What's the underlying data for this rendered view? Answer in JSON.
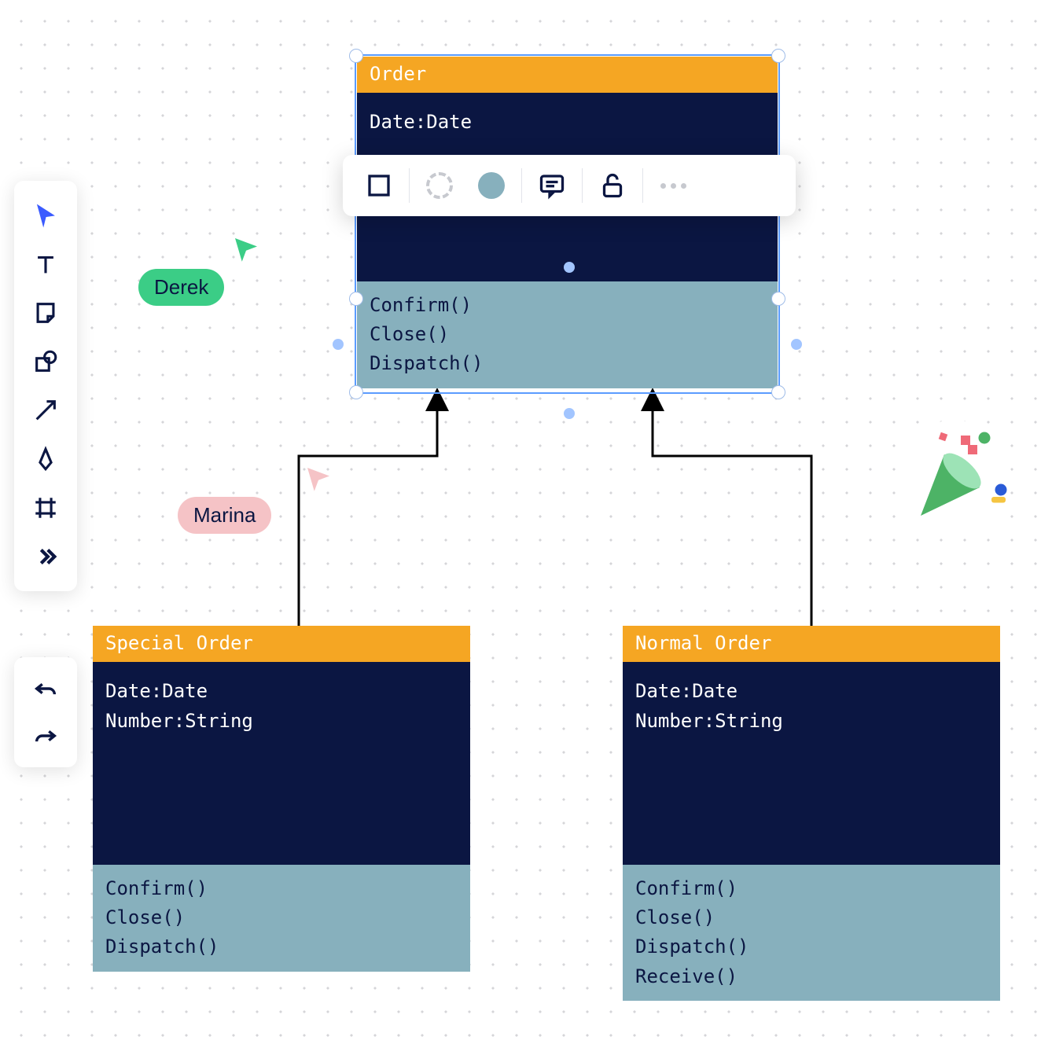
{
  "presence": {
    "derek": "Derek",
    "marina": "Marina"
  },
  "toolbox": {
    "select": "select",
    "text": "text",
    "sticky": "sticky-note",
    "shape": "shape",
    "arrow": "arrow",
    "pen": "pen",
    "frame": "frame",
    "more": "more",
    "undo": "undo",
    "redo": "redo"
  },
  "context_toolbar": {
    "shape_style": "square-outline",
    "border_style": "dashed",
    "fill_color": "#87b0bd",
    "comment": "comment",
    "lock": "unlock",
    "more": "more"
  },
  "diagram": {
    "order": {
      "title": "Order",
      "attrs": [
        "Date:Date"
      ],
      "methods": [
        "Confirm()",
        "Close()",
        "Dispatch()"
      ]
    },
    "special": {
      "title": "Special Order",
      "attrs": [
        "Date:Date",
        "Number:String"
      ],
      "methods": [
        "Confirm()",
        "Close()",
        "Dispatch()"
      ]
    },
    "normal": {
      "title": "Normal Order",
      "attrs": [
        "Date:Date",
        "Number:String"
      ],
      "methods": [
        "Confirm()",
        "Close()",
        "Dispatch()",
        "Receive()"
      ]
    }
  },
  "colors": {
    "header": "#f5a623",
    "body": "#0b1642",
    "footer": "#87b0bd",
    "selection": "#5b9cff",
    "derek": "#3bcd86",
    "marina": "#f5c3c6"
  }
}
